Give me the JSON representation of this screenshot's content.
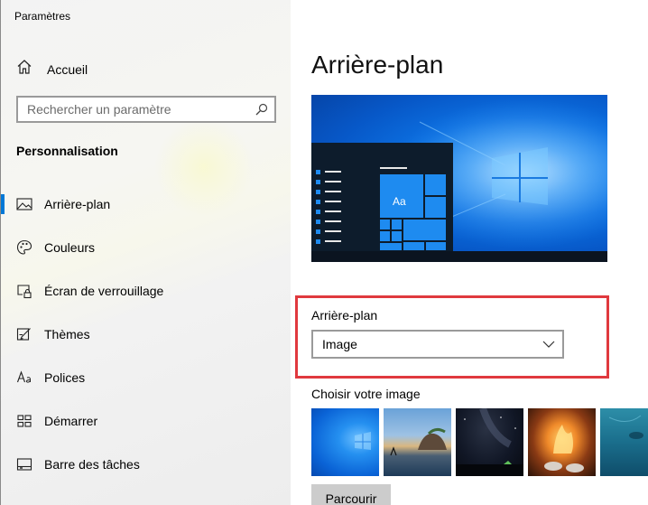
{
  "window": {
    "title": "Paramètres"
  },
  "sidebar": {
    "home_label": "Accueil",
    "search_placeholder": "Rechercher un paramètre",
    "section_title": "Personnalisation",
    "items": [
      {
        "label": "Arrière-plan",
        "icon": "image-icon",
        "active": true
      },
      {
        "label": "Couleurs",
        "icon": "palette-icon"
      },
      {
        "label": "Écran de verrouillage",
        "icon": "lock-screen-icon"
      },
      {
        "label": "Thèmes",
        "icon": "themes-icon"
      },
      {
        "label": "Polices",
        "icon": "fonts-icon"
      },
      {
        "label": "Démarrer",
        "icon": "start-icon"
      },
      {
        "label": "Barre des tâches",
        "icon": "taskbar-icon"
      }
    ]
  },
  "main": {
    "title": "Arrière-plan",
    "preview_tile_text": "Aa",
    "background_label": "Arrière-plan",
    "background_value": "Image",
    "choose_label": "Choisir votre image",
    "browse_label": "Parcourir"
  },
  "colors": {
    "accent": "#0078d7",
    "highlight": "#e0393e"
  }
}
